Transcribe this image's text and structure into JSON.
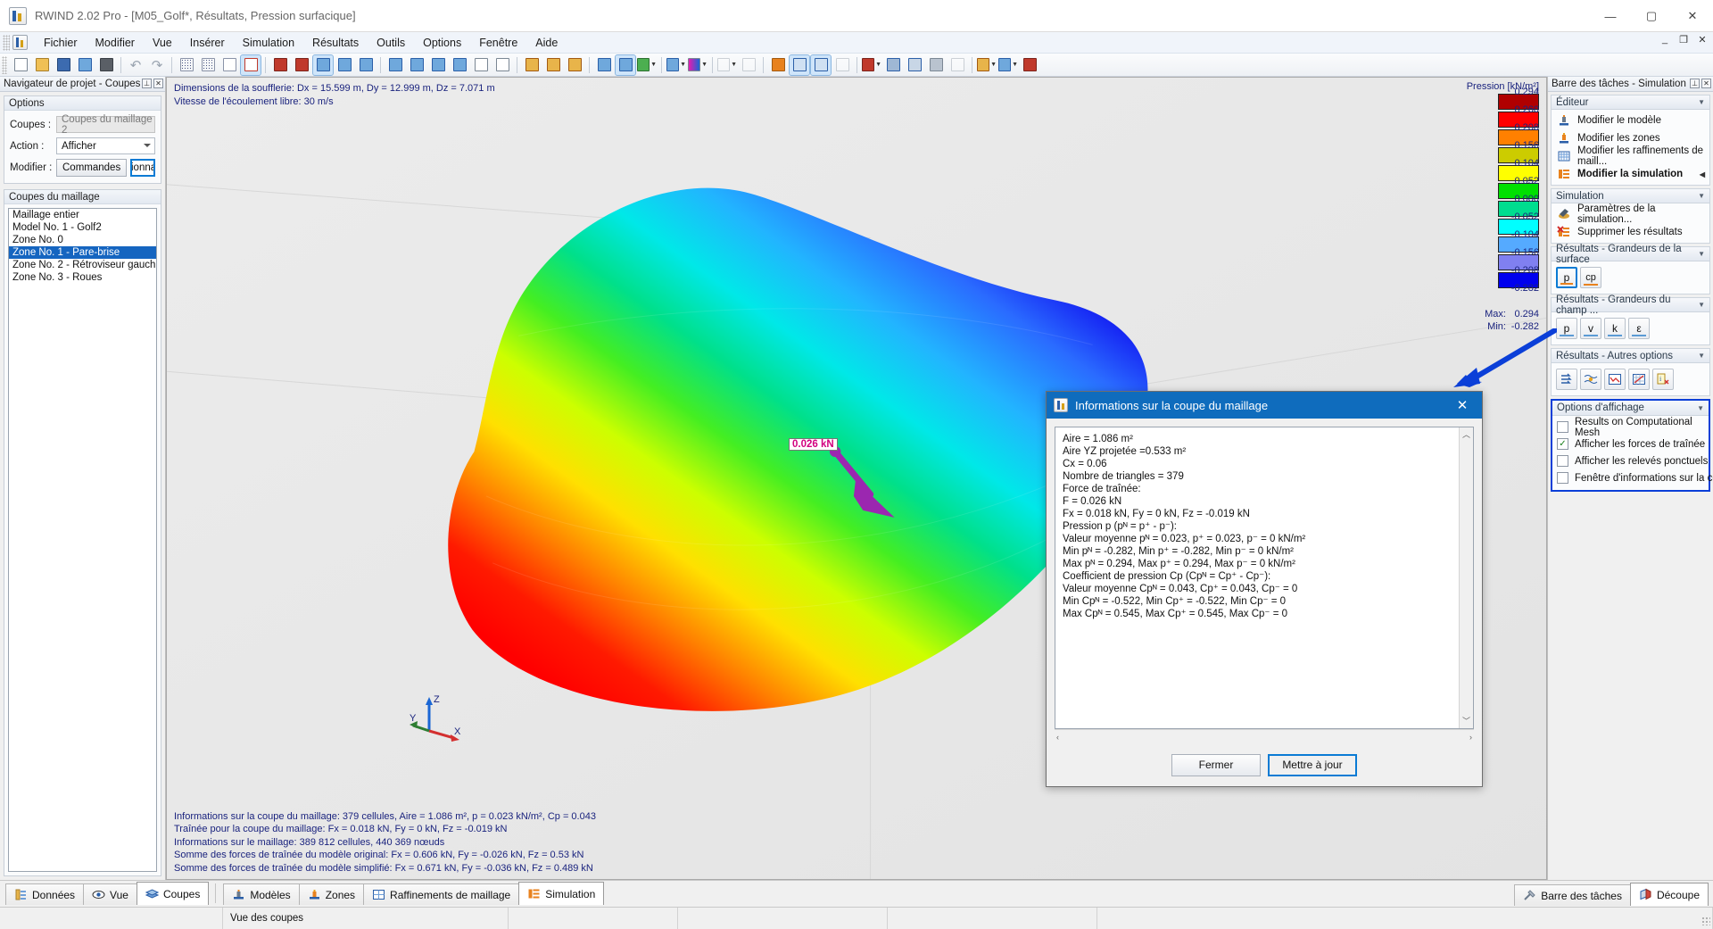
{
  "window": {
    "title": "RWIND 2.02 Pro - [M05_Golf*, Résultats, Pression surfacique]",
    "minimize": "—",
    "maximize": "▢",
    "close": "✕",
    "mdi_minimize": "_",
    "mdi_restore": "❐",
    "mdi_close": "✕"
  },
  "menu": {
    "items": [
      {
        "label": "Fichier"
      },
      {
        "label": "Modifier"
      },
      {
        "label": "Vue"
      },
      {
        "label": "Insérer"
      },
      {
        "label": "Simulation"
      },
      {
        "label": "Résultats"
      },
      {
        "label": "Outils"
      },
      {
        "label": "Options"
      },
      {
        "label": "Fenêtre"
      },
      {
        "label": "Aide"
      }
    ]
  },
  "left_panel": {
    "title": "Navigateur de projet - Coupes",
    "options_group": {
      "header": "Options",
      "coupes_label": "Coupes :",
      "coupes_value": "Coupes du maillage 2",
      "action_label": "Action :",
      "action_value": "Afficher",
      "modifier_label": "Modifier :",
      "commandes_button": "Commandes",
      "gestionnaire_button": "Gestionnaire..."
    },
    "list_group": {
      "header": "Coupes du maillage",
      "items": [
        {
          "label": "Maillage entier",
          "selected": false
        },
        {
          "label": "Model No. 1 - Golf2",
          "selected": false
        },
        {
          "label": "Zone No. 0",
          "selected": false
        },
        {
          "label": "Zone No. 1 - Pare-brise",
          "selected": true
        },
        {
          "label": "Zone No. 2 - Rétroviseur gauche",
          "selected": false
        },
        {
          "label": "Zone No. 3 - Roues",
          "selected": false
        }
      ]
    }
  },
  "viewport": {
    "top_info": "Dimensions de la soufflerie: Dx = 15.599 m, Dy = 12.999 m, Dz = 7.071 m\nVitesse de l'écoulement libre: 30 m/s",
    "bottom_info": "Informations sur la coupe du maillage: 379 cellules, Aire = 1.086 m², p = 0.023 kN/m², Cp = 0.043\nTraînée pour la coupe du maillage: Fx = 0.018 kN, Fy = 0 kN, Fz = -0.019 kN\nInformations sur le maillage: 389 812 cellules, 440 369 nœuds\nSomme des forces de traînée du modèle original: Fx = 0.606 kN, Fy = -0.026 kN, Fz = 0.53 kN\nSomme des forces de traînée du modèle simplifié: Fx = 0.671 kN, Fy = -0.036 kN, Fz = 0.489 kN",
    "force_label": "0.026 kN",
    "axis": {
      "x": "X",
      "y": "Y",
      "z": "Z"
    }
  },
  "legend": {
    "title": "Pression [kN/m²]",
    "bands": [
      {
        "color": "#b00000",
        "value": "0.294"
      },
      {
        "color": "#ff0000",
        "value": "0.260"
      },
      {
        "color": "#ff8000",
        "value": "0.208"
      },
      {
        "color": "#cccc00",
        "value": "0.156"
      },
      {
        "color": "#ffff00",
        "value": "0.104"
      },
      {
        "color": "#00e000",
        "value": "0.052"
      },
      {
        "color": "#00dd8f",
        "value": "0.000"
      },
      {
        "color": "#00ffff",
        "value": "-0.052"
      },
      {
        "color": "#55aaff",
        "value": "-0.104"
      },
      {
        "color": "#8080f0",
        "value": "-0.156"
      },
      {
        "color": "#0000ee",
        "value": "-0.208"
      }
    ],
    "last_value": "-0.282",
    "max_label": "Max:",
    "max_value": "0.294",
    "min_label": "Min:",
    "min_value": "-0.282"
  },
  "dialog": {
    "title": "Informations sur la coupe du maillage",
    "close": "✕",
    "content": "Aire = 1.086 m²\nAire YZ projetée =0.533 m²\nCx = 0.06\nNombre de triangles = 379\nForce de traînée:\nF = 0.026 kN\nFx = 0.018 kN, Fy = 0 kN, Fz = -0.019 kN\nPression p (pᴺ = p⁺ - p⁻):\nValeur moyenne pᴺ = 0.023, p⁺ = 0.023, p⁻ = 0 kN/m²\nMin pᴺ = -0.282, Min p⁺ = -0.282, Min p⁻ = 0 kN/m²\nMax pᴺ = 0.294, Max p⁺ = 0.294, Max p⁻ = 0 kN/m²\nCoefficient de pression Cp (Cpᴺ = Cp⁺ - Cp⁻):\nValeur moyenne Cpᴺ = 0.043, Cp⁺ = 0.043, Cp⁻ = 0\nMin Cpᴺ = -0.522, Min Cp⁺ = -0.522, Min Cp⁻ = 0\nMax Cpᴺ = 0.545, Max Cp⁺ = 0.545, Max Cp⁻ = 0",
    "close_button": "Fermer",
    "update_button": "Mettre à jour",
    "scroll_up": "︿",
    "scroll_down": "﹀",
    "scroll_left": "‹",
    "scroll_right": "›"
  },
  "right_panel": {
    "title": "Barre des tâches - Simulation",
    "sections": [
      {
        "header": "Éditeur",
        "items": [
          {
            "label": "Modifier le modèle",
            "bold": false,
            "icon": "model-icon"
          },
          {
            "label": "Modifier les zones",
            "bold": false,
            "icon": "zones-icon"
          },
          {
            "label": "Modifier les raffinements de maill...",
            "bold": false,
            "icon": "mesh-refine-icon"
          },
          {
            "label": "Modifier la simulation",
            "bold": true,
            "icon": "simulation-icon"
          }
        ]
      },
      {
        "header": "Simulation",
        "items": [
          {
            "label": "Paramètres de la simulation...",
            "bold": false,
            "icon": "settings-icon"
          },
          {
            "label": "Supprimer les résultats",
            "bold": false,
            "icon": "delete-results-icon"
          }
        ]
      }
    ],
    "surface_section": {
      "header": "Résultats - Grandeurs de la surface",
      "buttons": [
        {
          "label": "p",
          "selected": true
        },
        {
          "label": "cp",
          "selected": false
        }
      ]
    },
    "field_section": {
      "header": "Résultats - Grandeurs du champ ...",
      "buttons": [
        {
          "label": "p",
          "selected": false
        },
        {
          "label": "v",
          "selected": false
        },
        {
          "label": "k",
          "selected": false
        },
        {
          "label": "ε",
          "selected": false
        }
      ]
    },
    "other_section": {
      "header": "Résultats - Autres options",
      "buttons": [
        {
          "name": "streamlines-icon"
        },
        {
          "name": "isosurface-icon"
        },
        {
          "name": "convergence-chart-icon"
        },
        {
          "name": "graph-icon"
        },
        {
          "name": "section-info-icon"
        }
      ]
    },
    "display_section": {
      "header": "Options d'affichage",
      "checkboxes": [
        {
          "label": "Results on Computational Mesh",
          "checked": false
        },
        {
          "label": "Afficher les forces de traînée",
          "checked": true
        },
        {
          "label": "Afficher les relevés ponctuels",
          "checked": false
        },
        {
          "label": "Fenêtre d'informations sur la coupe",
          "checked": false
        }
      ],
      "check_glyph": "✓"
    },
    "pin": "⊥",
    "close": "✕"
  },
  "bottom": {
    "left_tabs": [
      {
        "label": "Données",
        "active": false
      },
      {
        "label": "Vue",
        "active": false
      },
      {
        "label": "Coupes",
        "active": true
      }
    ],
    "center_tabs": [
      {
        "label": "Modèles",
        "active": false
      },
      {
        "label": "Zones",
        "active": false
      },
      {
        "label": "Raffinements de maillage",
        "active": false
      },
      {
        "label": "Simulation",
        "active": true
      }
    ],
    "right_tabs": [
      {
        "label": "Barre des tâches",
        "active": false
      },
      {
        "label": "Découpe",
        "active": true
      }
    ],
    "status_cells": [
      "",
      "Vue des coupes",
      "",
      "",
      "",
      "",
      ""
    ]
  },
  "colors": {
    "accent": "#0f6cbd",
    "selection": "#1565c0",
    "text_blue": "#1a237e",
    "annot_blue": "#0b3fd8",
    "force_pink": "#d2007f"
  }
}
